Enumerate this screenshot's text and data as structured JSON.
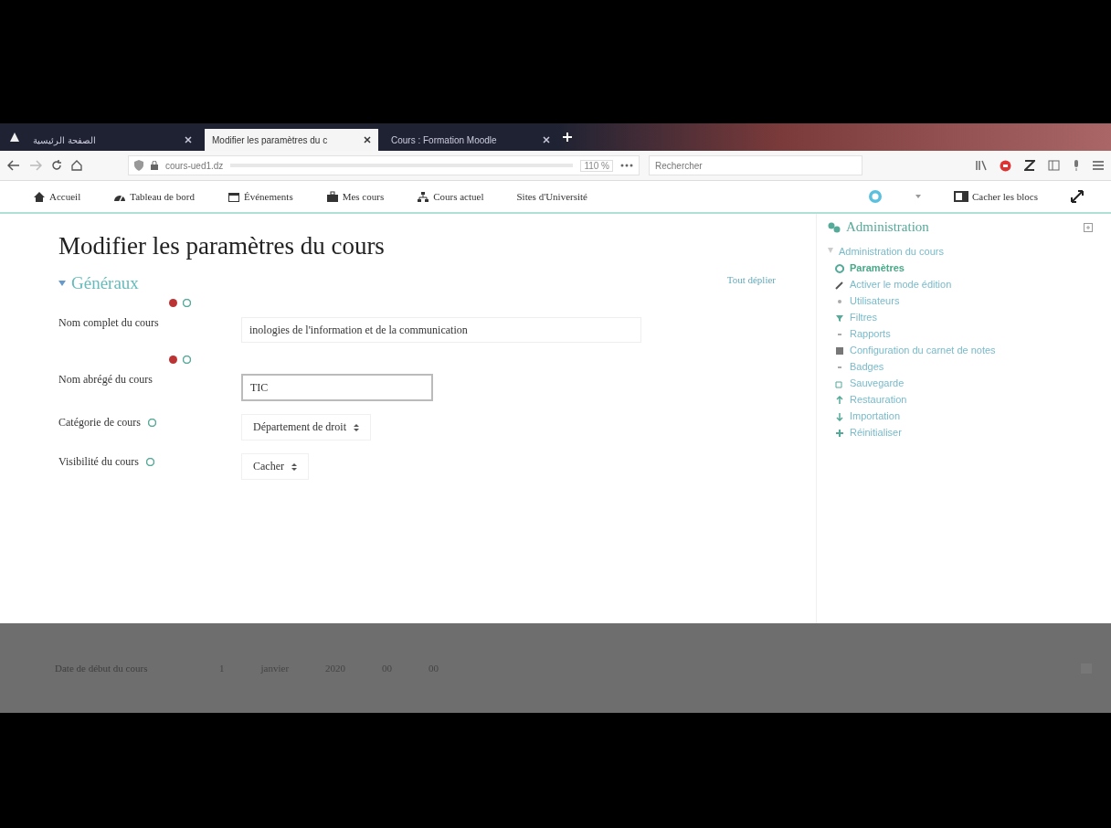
{
  "browser": {
    "tabs": [
      {
        "label": "الصفحة الرئيسية",
        "selected": false
      },
      {
        "label": "Modifier les paramètres du c",
        "selected": true
      },
      {
        "label": "Cours : Formation Moodle",
        "selected": false
      }
    ],
    "url": "cours-ued1.dz",
    "zoom": "110 %",
    "search": {
      "placeholder": "Rechercher"
    }
  },
  "navbar": {
    "items": [
      {
        "label": "Accueil"
      },
      {
        "label": "Tableau de bord"
      },
      {
        "label": "Événements"
      },
      {
        "label": "Mes cours"
      },
      {
        "label": "Cours actuel"
      },
      {
        "label": "Sites d'Université"
      }
    ],
    "hide_blocks": "Cacher les blocs"
  },
  "page": {
    "title": "Modifier les paramètres du cours",
    "expand_all": "Tout déplier",
    "section": "Généraux",
    "fields": [
      {
        "kind": "text",
        "label": "Nom complet du cours",
        "required": true,
        "value": "inologies de l'information et de la communication"
      },
      {
        "kind": "text",
        "label": "Nom abrégé du cours",
        "required": true,
        "value": "TIC",
        "focused": true
      },
      {
        "kind": "select",
        "label": "Catégorie de cours",
        "required": false,
        "value": "Département de droit"
      },
      {
        "kind": "select",
        "label": "Visibilité du cours",
        "required": false,
        "value": "Cacher"
      }
    ],
    "dimmed_field": {
      "label": "Date de début du cours",
      "parts": [
        "1",
        "janvier",
        "2020",
        "00",
        "00"
      ]
    }
  },
  "admin_block": {
    "title": "Administration",
    "items": [
      {
        "label": "Administration du cours",
        "children": [
          {
            "label": "Paramètres",
            "current": true
          },
          {
            "label": "Activer le mode édition",
            "current": false
          },
          {
            "label": "Utilisateurs",
            "current": false
          },
          {
            "label": "Filtres",
            "current": false
          },
          {
            "label": "Rapports",
            "current": false
          },
          {
            "label": "Configuration du carnet de notes",
            "current": false
          },
          {
            "label": "Badges",
            "current": false
          },
          {
            "label": "Sauvegarde",
            "current": false
          },
          {
            "label": "Restauration",
            "current": false
          },
          {
            "label": "Importation",
            "current": false
          },
          {
            "label": "Réinitialiser",
            "current": false
          }
        ]
      }
    ]
  }
}
